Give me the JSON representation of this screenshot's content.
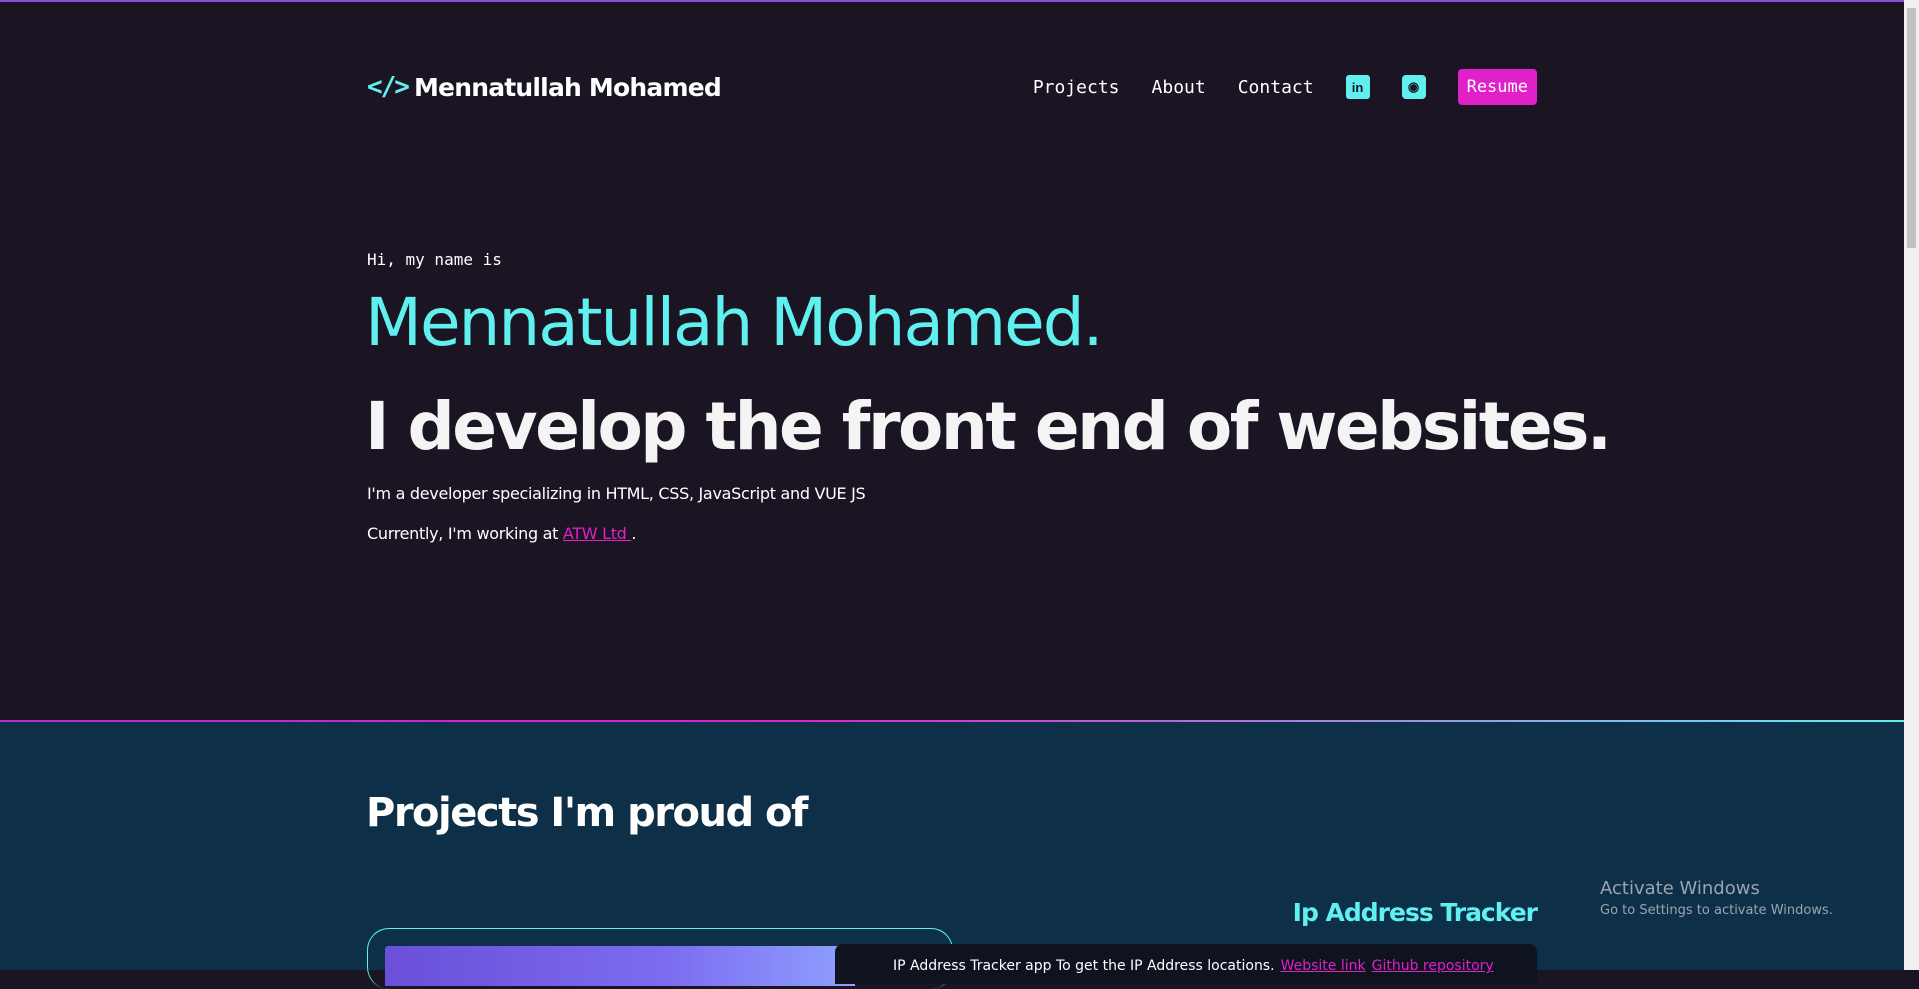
{
  "header": {
    "logo_code": "</>",
    "logo_name": "Mennatullah Mohamed",
    "nav": [
      "Projects",
      "About",
      "Contact"
    ],
    "linkedin_icon": "in",
    "github_icon": "◉",
    "resume_label": "Resume"
  },
  "hero": {
    "intro": "Hi, my name is",
    "name": "Mennatullah Mohamed.",
    "tagline": "I develop the front end of websites.",
    "description": "I'm a developer specializing in HTML, CSS, JavaScript and VUE JS",
    "working_prefix": "Currently, I'm working at ",
    "company": "ATW Ltd ",
    "working_suffix": "."
  },
  "projects": {
    "title": "Projects I'm proud of",
    "items": [
      {
        "name": "Ip Address Tracker",
        "description": "IP Address Tracker app To get the IP Address locations.",
        "website_link": "Website link",
        "github_link": "Github repository"
      }
    ]
  },
  "watermark": {
    "line1": "Activate Windows",
    "line2": "Go to Settings to activate Windows."
  },
  "colors": {
    "accent_cyan": "#60f0f0",
    "accent_pink": "#e020c8",
    "hero_bg": "#1a1423",
    "projects_bg": "#0e2f48"
  }
}
